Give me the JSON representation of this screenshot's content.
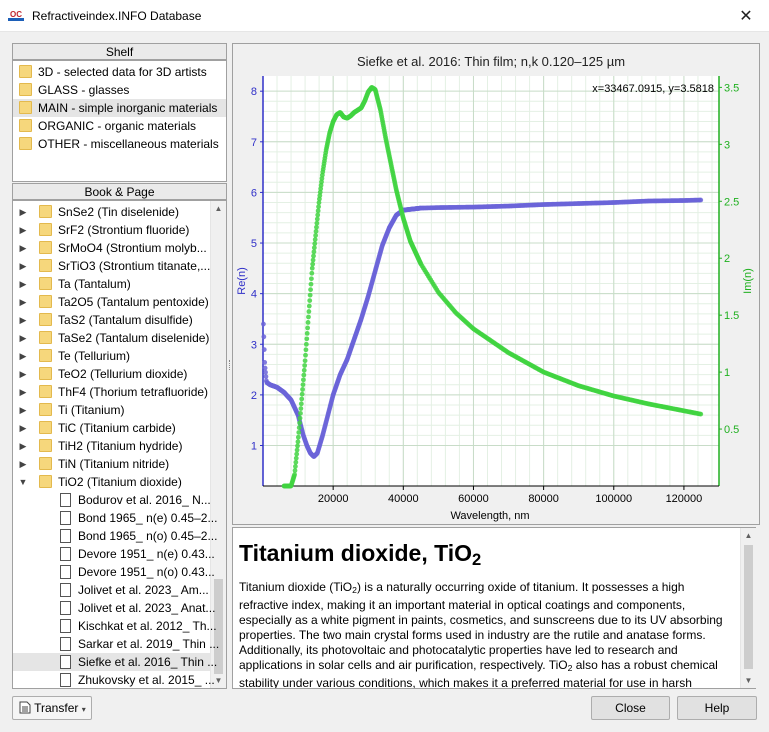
{
  "window": {
    "title": "Refractiveindex.INFO Database",
    "icon_text": "OC"
  },
  "shelf": {
    "header": "Shelf",
    "items": [
      "3D - selected data for 3D artists",
      "GLASS - glasses",
      "MAIN - simple inorganic materials",
      "ORGANIC - organic materials",
      "OTHER - miscellaneous materials"
    ],
    "selected_index": 2
  },
  "book": {
    "header": "Book & Page",
    "books": [
      "SnSe2 (Tin diselenide)",
      "SrF2 (Strontium fluoride)",
      "SrMoO4 (Strontium molyb...",
      "SrTiO3 (Strontium titanate,...",
      "Ta (Tantalum)",
      "Ta2O5 (Tantalum pentoxide)",
      "TaS2 (Tantalum disulfide)",
      "TaSe2 (Tantalum diselenide)",
      "Te (Tellurium)",
      "TeO2 (Tellurium dioxide)",
      "ThF4 (Thorium tetrafluoride)",
      "Ti (Titanium)",
      "TiC (Titanium carbide)",
      "TiH2 (Titanium hydride)",
      "TiN (Titanium nitride)",
      "TiO2 (Titanium dioxide)"
    ],
    "pages": [
      "Bodurov et al. 2016_ N...",
      "Bond 1965_ n(e) 0.45–2...",
      "Bond 1965_ n(o) 0.45–2...",
      "Devore 1951_ n(e) 0.43...",
      "Devore 1951_ n(o) 0.43...",
      "Jolivet et al. 2023_ Am...",
      "Jolivet et al. 2023_ Anat...",
      "Kischkat et al. 2012_ Th...",
      "Sarkar et al. 2019_ Thin ...",
      "Siefke et al. 2016_ Thin ...",
      "Zhukovsky et al. 2015_ ..."
    ],
    "selected_page_index": 9,
    "expanded_book_index": 15
  },
  "chart_data": {
    "type": "line",
    "title": "Siefke et al. 2016: Thin film; n,k 0.120–125 µm",
    "readout": "x=33467.0915, y=3.5818",
    "xlabel": "Wavelength, nm",
    "ylabel_left": "Re(n)",
    "ylabel_right": "Im(n)",
    "xlim": [
      0,
      130000
    ],
    "ylim_left": [
      0.2,
      8.3
    ],
    "ylim_right": [
      0,
      3.6
    ],
    "xticks": [
      20000,
      40000,
      60000,
      80000,
      100000,
      120000
    ],
    "xtick_labels": [
      "20000",
      "40000",
      "60000",
      "80000",
      "100000",
      "120000"
    ],
    "yticks_left": [
      1,
      2,
      3,
      4,
      5,
      6,
      7,
      8
    ],
    "yticks_right": [
      0.5,
      1,
      1.5,
      2,
      2.5,
      3,
      3.5
    ],
    "grid": true,
    "series": [
      {
        "axis": "left",
        "color": "#6b64d8",
        "x": [
          120,
          500,
          1000,
          2000,
          4000,
          6000,
          8000,
          10000,
          11500,
          12500,
          13500,
          14500,
          15500,
          17000,
          18500,
          20000,
          22000,
          24000,
          26000,
          28000,
          30000,
          32000,
          34000,
          36000,
          38000,
          40000,
          45000,
          50000,
          60000,
          70000,
          80000,
          90000,
          100000,
          110000,
          120000,
          125000
        ],
        "y": [
          3.4,
          2.6,
          2.25,
          2.2,
          2.15,
          2.05,
          1.9,
          1.6,
          1.2,
          1.0,
          0.85,
          0.78,
          0.85,
          1.2,
          1.6,
          2.0,
          2.4,
          2.7,
          3.1,
          3.5,
          3.95,
          4.45,
          4.95,
          5.3,
          5.55,
          5.65,
          5.69,
          5.7,
          5.71,
          5.73,
          5.76,
          5.78,
          5.8,
          5.83,
          5.84,
          5.85
        ]
      },
      {
        "axis": "right",
        "color": "#41d441",
        "x": [
          6000,
          8000,
          9000,
          10000,
          11000,
          12000,
          13000,
          14000,
          15000,
          16000,
          17000,
          18000,
          19000,
          20000,
          21000,
          22000,
          23000,
          24000,
          25000,
          26000,
          27000,
          28000,
          29000,
          30000,
          31000,
          32000,
          33500,
          35000,
          36000,
          37000,
          38000,
          40000,
          42000,
          45000,
          50000,
          55000,
          60000,
          70000,
          80000,
          90000,
          100000,
          110000,
          120000,
          125000
        ],
        "y": [
          0.0,
          0.0,
          0.1,
          0.4,
          0.75,
          1.1,
          1.5,
          1.9,
          2.2,
          2.5,
          2.75,
          2.95,
          3.1,
          3.2,
          3.26,
          3.28,
          3.24,
          3.23,
          3.25,
          3.28,
          3.3,
          3.32,
          3.38,
          3.46,
          3.5,
          3.48,
          3.3,
          3.05,
          2.9,
          2.75,
          2.6,
          2.35,
          2.15,
          1.95,
          1.7,
          1.52,
          1.38,
          1.17,
          1.0,
          0.88,
          0.79,
          0.72,
          0.66,
          0.63
        ]
      }
    ]
  },
  "description": {
    "heading_text": "Titanium dioxide, TiO",
    "heading_sub": "2",
    "para_part1": "Titanium dioxide (TiO",
    "para_sub1": "2",
    "para_part2": ") is a naturally occurring oxide of titanium. It possesses a high refractive index, making it an important material in optical coatings and components, especially as a white pigment in paints, cosmetics, and sunscreens due to its UV absorbing properties. The two main crystal forms used in industry are the rutile and anatase forms. Additionally, its photovoltaic and photocatalytic properties have led to research and applications in solar cells and air purification, respectively. TiO",
    "para_sub2": "2",
    "para_part3": " also has a robust chemical stability under various conditions, which makes it a preferred material for use in harsh environments."
  },
  "buttons": {
    "transfer": "Transfer",
    "close": "Close",
    "help": "Help"
  },
  "colors": {
    "left_axis": "#3030c8",
    "right_axis": "#20b020",
    "grid_minor": "#e4f0e4",
    "grid_major": "#c8dcc8"
  }
}
